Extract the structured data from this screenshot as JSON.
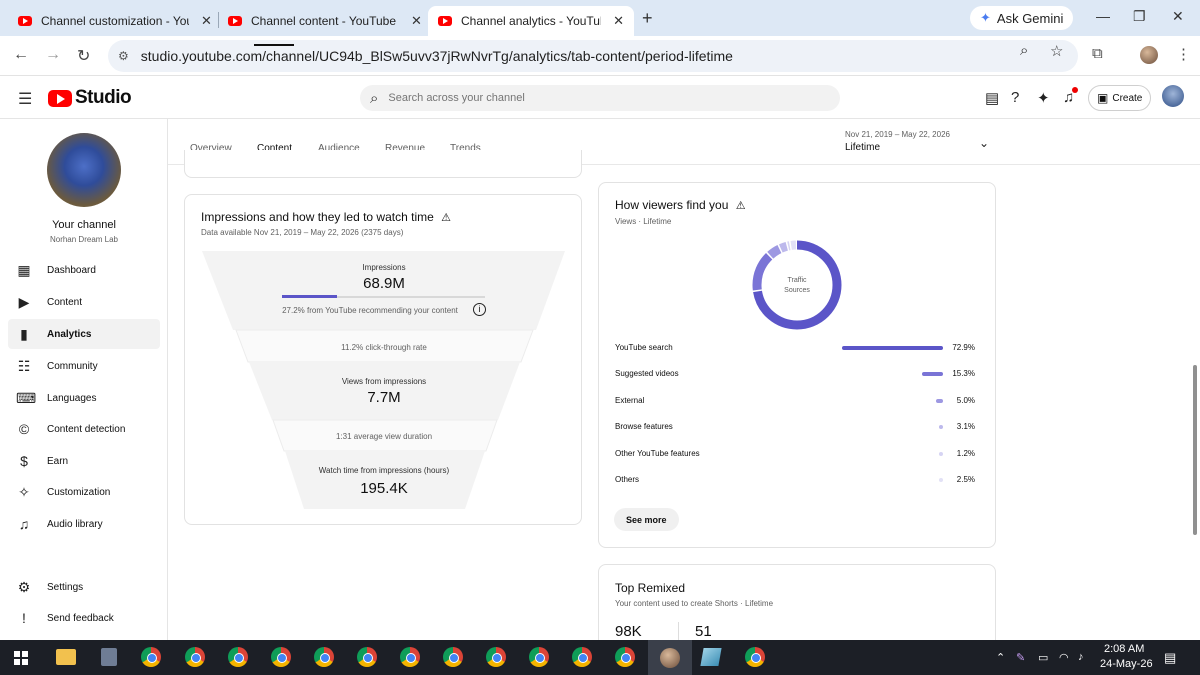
{
  "browser": {
    "tabs": [
      {
        "title": "Channel customization - YouTu"
      },
      {
        "title": "Channel content - YouTube Stu"
      },
      {
        "title": "Channel analytics - YouTube St"
      }
    ],
    "tab_close": "✕",
    "new_tab": "+",
    "gemini_label": "Ask Gemini",
    "url": "studio.youtube.com/channel/UC94b_BlSw5uvv37jRwNvrTg/analytics/tab-content/period-lifetime"
  },
  "studio": {
    "logo_text": "Studio",
    "search_placeholder": "Search across your channel",
    "create_label": "Create"
  },
  "sidebar": {
    "your_channel": "Your channel",
    "channel_name": "Norhan Dream Lab",
    "items": [
      {
        "label": "Dashboard",
        "icon": "dashboard-icon",
        "glyph": "▦"
      },
      {
        "label": "Content",
        "icon": "content-icon",
        "glyph": "▶"
      },
      {
        "label": "Analytics",
        "icon": "analytics-icon",
        "glyph": "▮"
      },
      {
        "label": "Community",
        "icon": "community-icon",
        "glyph": "☷"
      },
      {
        "label": "Languages",
        "icon": "languages-icon",
        "glyph": "⌨"
      },
      {
        "label": "Content detection",
        "icon": "copyright-icon",
        "glyph": "©"
      },
      {
        "label": "Earn",
        "icon": "dollar-icon",
        "glyph": "$"
      },
      {
        "label": "Customization",
        "icon": "magic-wand-icon",
        "glyph": "✧"
      },
      {
        "label": "Audio library",
        "icon": "audio-library-icon",
        "glyph": "♫"
      },
      {
        "label": "Settings",
        "icon": "gear-icon",
        "glyph": "⚙"
      },
      {
        "label": "Send feedback",
        "icon": "feedback-icon",
        "glyph": "!"
      }
    ]
  },
  "analytics": {
    "tabs": [
      "Overview",
      "Content",
      "Audience",
      "Revenue",
      "Trends"
    ],
    "active_tab": "Content",
    "period": {
      "dates": "Nov 21, 2019 – May 22, 2026",
      "label": "Lifetime"
    }
  },
  "impressions_card": {
    "title": "Impressions and how they led to watch time",
    "subtitle": "Data available Nov 21, 2019 – May 22, 2026 (2375 days)",
    "impressions_label": "Impressions",
    "impressions_value": "68.9M",
    "recommend_note": "27.2% from YouTube recommending your content",
    "recommend_fraction": 0.272,
    "ctr_note": "11.2% click-through rate",
    "views_label": "Views from impressions",
    "views_value": "7.7M",
    "avd_note": "1:31 average view duration",
    "watch_label": "Watch time from impressions (hours)",
    "watch_value": "195.4K"
  },
  "traffic_card": {
    "title": "How viewers find you",
    "subtitle": "Views · Lifetime",
    "donut_label_1": "Traffic",
    "donut_label_2": "Sources",
    "sources": [
      {
        "name": "YouTube search",
        "pct": "72.9%",
        "value": 72.9,
        "color": "#5b55c8"
      },
      {
        "name": "Suggested videos",
        "pct": "15.3%",
        "value": 15.3,
        "color": "#7a74d6"
      },
      {
        "name": "External",
        "pct": "5.0%",
        "value": 5.0,
        "color": "#9d98e2"
      },
      {
        "name": "Browse features",
        "pct": "3.1%",
        "value": 3.1,
        "color": "#bdb9ec"
      },
      {
        "name": "Other YouTube features",
        "pct": "1.2%",
        "value": 1.2,
        "color": "#d6d4f3"
      },
      {
        "name": "Others",
        "pct": "2.5%",
        "value": 2.5,
        "color": "#e2e1f6"
      }
    ],
    "see_more": "See more"
  },
  "remix_card": {
    "title": "Top Remixed",
    "subtitle": "Your content used to create Shorts · Lifetime",
    "stat_1": "98K",
    "stat_2": "51"
  },
  "taskbar": {
    "time": "2:08 AM",
    "date": "24-May-26"
  },
  "colors": {
    "accent": "#5b55c8",
    "youtube_red": "#ff0000",
    "taskbar": "#1c1f26"
  }
}
